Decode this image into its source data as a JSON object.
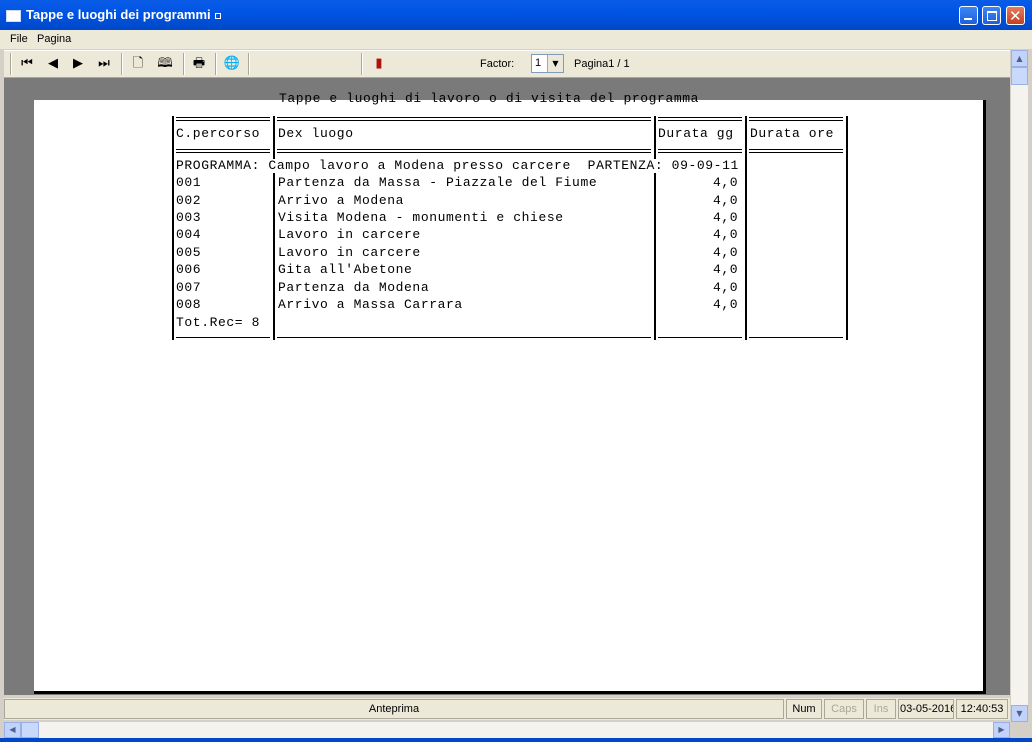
{
  "window": {
    "title": "Tappe e luoghi dei programmi"
  },
  "menu": {
    "file": "File",
    "pagina": "Pagina"
  },
  "toolbar": {
    "factor_label": "Factor:",
    "factor_value": "1",
    "page_info": "Pagina1 / 1",
    "icons": [
      "first-page-icon",
      "prev-page-icon",
      "next-page-icon",
      "last-page-icon",
      "single-page-icon",
      "two-pages-icon",
      "print-icon",
      "export-icon",
      "exit-icon"
    ]
  },
  "report": {
    "title": "Tappe e luoghi di lavoro o di visita del programma",
    "headers": {
      "c_percorso": "C.percorso",
      "dex_luogo": "Dex luogo",
      "durata_gg": "Durata gg",
      "durata_ore": "Durata ore"
    },
    "programma_line": "PROGRAMMA: Campo lavoro a Modena presso carcere  PARTENZA: 09-09-11",
    "rows": [
      {
        "code": "001",
        "luogo": "Partenza da Massa - Piazzale del Fiume",
        "gg": "4,0"
      },
      {
        "code": "002",
        "luogo": "Arrivo a Modena",
        "gg": "4,0"
      },
      {
        "code": "003",
        "luogo": "Visita Modena - monumenti e chiese",
        "gg": "4,0"
      },
      {
        "code": "004",
        "luogo": "Lavoro in carcere",
        "gg": "4,0"
      },
      {
        "code": "005",
        "luogo": "Lavoro in carcere",
        "gg": "4,0"
      },
      {
        "code": "006",
        "luogo": "Gita all'Abetone",
        "gg": "4,0"
      },
      {
        "code": "007",
        "luogo": "Partenza da Modena",
        "gg": "4,0"
      },
      {
        "code": "008",
        "luogo": "Arrivo a Massa Carrara",
        "gg": "4,0"
      }
    ],
    "total": "Tot.Rec= 8"
  },
  "status": {
    "main": "Anteprima",
    "num": "Num",
    "caps": "Caps",
    "ins": "Ins",
    "date": "03-05-2016",
    "time": "12:40:53"
  }
}
